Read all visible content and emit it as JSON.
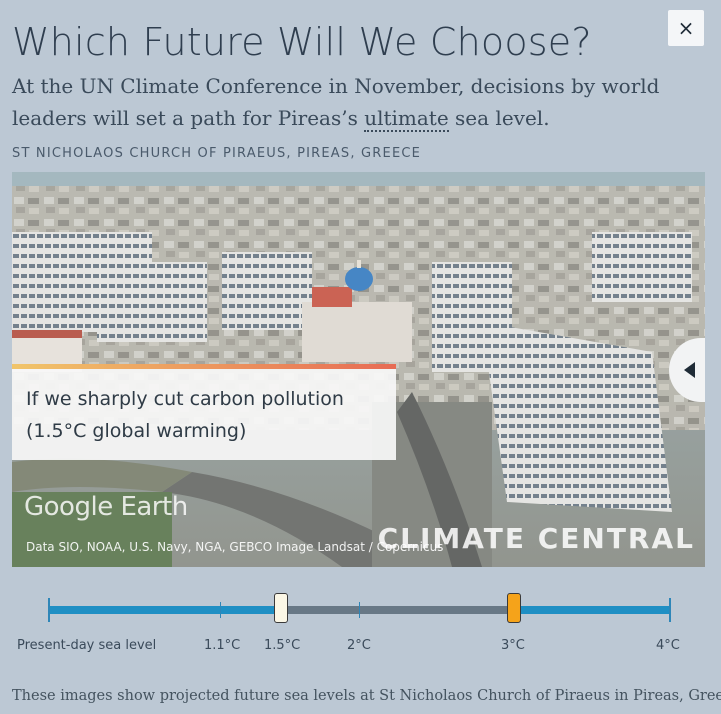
{
  "header": {
    "title": "Which Future Will We Choose?",
    "close_label": "×",
    "subtitle_before": "At the UN Climate Conference in November, decisions by world leaders will set a path for Pireas’s ",
    "subtitle_link": "ultimate",
    "subtitle_after": " sea level.",
    "location": "ST NICHOLAOS CHURCH OF PIRAEUS, PIREAS, GREECE"
  },
  "image": {
    "overlay_text": "If we sharply cut carbon pollution (1.5°C global warming)",
    "google_earth_logo": "Google Earth",
    "credits": "Data SIO, NOAA, U.S. Navy, NGA, GEBCO Image Landsat / Copernicus",
    "watermark": "CLIMATE CENTRAL",
    "next_button_icon": "triangle-left-icon"
  },
  "slider": {
    "labels": {
      "present": "Present-day sea level",
      "t11": "1.1°C",
      "t15": "1.5°C",
      "t2": "2°C",
      "t3": "3°C",
      "t4": "4°C"
    },
    "selected_handle": "1.5°C",
    "secondary_handle": "3°C",
    "colors": {
      "track_active": "#1f8fc4",
      "track_inactive": "#687886",
      "handle_selected": "#fbf7e6",
      "handle_secondary": "#f5a31a"
    }
  },
  "footer": {
    "caption": "These images show projected future sea levels at St Nicholaos Church of Piraeus in Pireas, Greece"
  }
}
